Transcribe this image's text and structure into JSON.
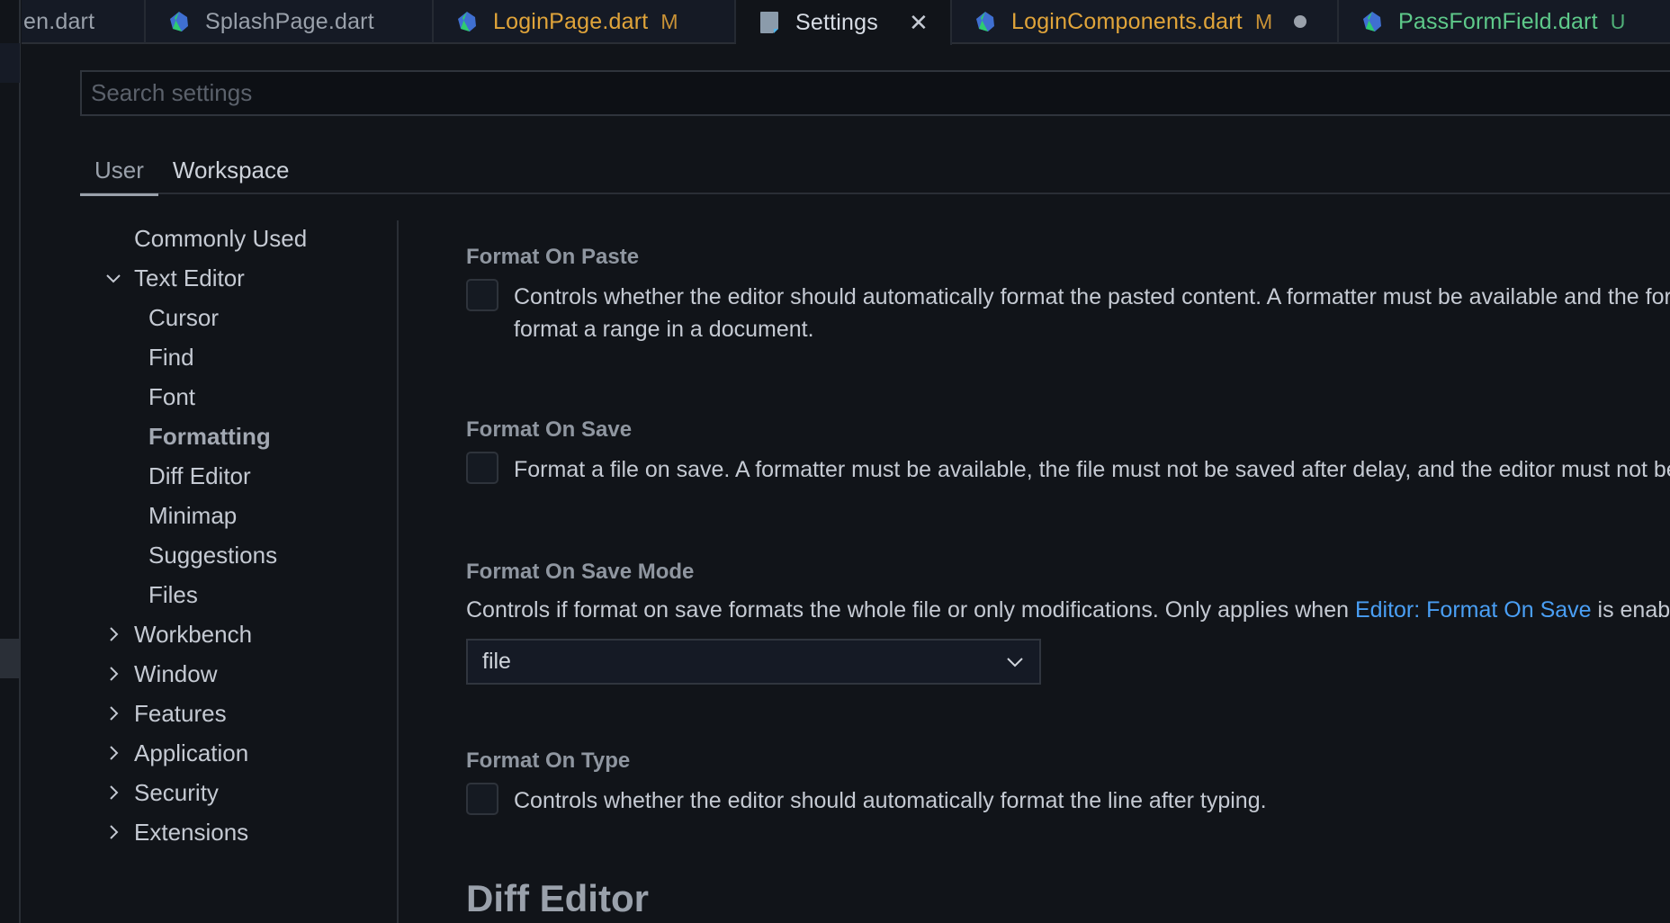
{
  "tabs": [
    {
      "label": "en.dart",
      "icon": "none",
      "status": "normal",
      "badge": ""
    },
    {
      "label": "SplashPage.dart",
      "icon": "dart-icon",
      "status": "normal",
      "badge": ""
    },
    {
      "label": "LoginPage.dart",
      "icon": "dart-icon",
      "status": "modified",
      "badge": "M"
    },
    {
      "label": "Settings",
      "icon": "settings-file-icon",
      "status": "active",
      "badge": "",
      "close_glyph": "✕"
    },
    {
      "label": "LoginComponents.dart",
      "icon": "dart-icon",
      "status": "modified",
      "badge": "M",
      "dirty": true
    },
    {
      "label": "PassFormField.dart",
      "icon": "dart-icon",
      "status": "untracked",
      "badge": "U"
    }
  ],
  "search": {
    "placeholder": "Search settings",
    "value": ""
  },
  "scope_tabs": [
    {
      "label": "User",
      "active": true
    },
    {
      "label": "Workspace",
      "active": false
    }
  ],
  "toc": [
    {
      "label": "Commonly Used",
      "level": 0,
      "chevron": ""
    },
    {
      "label": "Text Editor",
      "level": 0,
      "chevron": "down"
    },
    {
      "label": "Cursor",
      "level": 1,
      "chevron": ""
    },
    {
      "label": "Find",
      "level": 1,
      "chevron": ""
    },
    {
      "label": "Font",
      "level": 1,
      "chevron": ""
    },
    {
      "label": "Formatting",
      "level": 1,
      "chevron": "",
      "selected": true
    },
    {
      "label": "Diff Editor",
      "level": 1,
      "chevron": ""
    },
    {
      "label": "Minimap",
      "level": 1,
      "chevron": ""
    },
    {
      "label": "Suggestions",
      "level": 1,
      "chevron": ""
    },
    {
      "label": "Files",
      "level": 1,
      "chevron": ""
    },
    {
      "label": "Workbench",
      "level": 0,
      "chevron": "right"
    },
    {
      "label": "Window",
      "level": 0,
      "chevron": "right"
    },
    {
      "label": "Features",
      "level": 0,
      "chevron": "right"
    },
    {
      "label": "Application",
      "level": 0,
      "chevron": "right"
    },
    {
      "label": "Security",
      "level": 0,
      "chevron": "right"
    },
    {
      "label": "Extensions",
      "level": 0,
      "chevron": "right"
    }
  ],
  "settings": {
    "format_on_paste": {
      "title": "Format On Paste",
      "checked": false,
      "desc_line1": "Controls whether the editor should automatically format the pasted content. A formatter must be available and the formatter should be able to",
      "desc_line2": "format a range in a document."
    },
    "format_on_save": {
      "title": "Format On Save",
      "checked": false,
      "desc": "Format a file on save. A formatter must be available, the file must not be saved after delay, and the editor must not be shutting down."
    },
    "format_on_save_mode": {
      "title": "Format On Save Mode",
      "desc_prefix": "Controls if format on save formats the whole file or only modifications. Only applies when ",
      "desc_link": "Editor: Format On Save",
      "desc_suffix": " is enabled.",
      "selected_value": "file"
    },
    "format_on_type": {
      "title": "Format On Type",
      "checked": false,
      "desc": "Controls whether the editor should automatically format the line after typing."
    }
  },
  "next_section_heading": "Diff Editor",
  "colors": {
    "modified": "#e0a43a",
    "untracked": "#5ec98a",
    "link": "#4a9ff5",
    "background": "#111419"
  }
}
